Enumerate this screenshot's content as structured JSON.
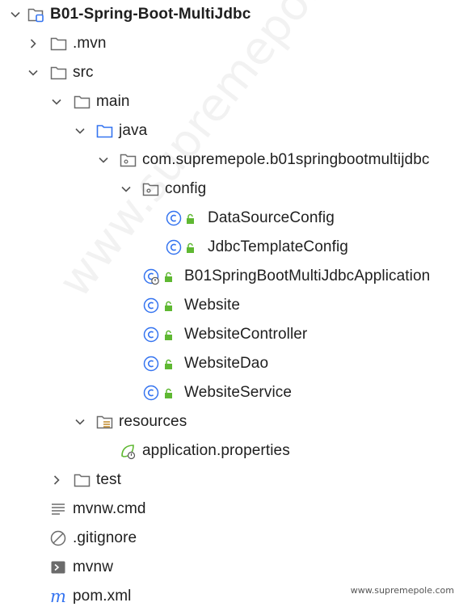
{
  "tree": {
    "project": "B01-Spring-Boot-MultiJdbc",
    "mvn": ".mvn",
    "src": "src",
    "main": "main",
    "java": "java",
    "package": "com.supremepole.b01springbootmultijdbc",
    "config": "config",
    "datasource_config": "DataSourceConfig",
    "jdbc_template_config": "JdbcTemplateConfig",
    "application_class": "B01SpringBootMultiJdbcApplication",
    "website": "Website",
    "website_controller": "WebsiteController",
    "website_dao": "WebsiteDao",
    "website_service": "WebsiteService",
    "resources": "resources",
    "application_properties": "application.properties",
    "test": "test",
    "mvnw_cmd": "mvnw.cmd",
    "gitignore": ".gitignore",
    "mvnw": "mvnw",
    "pom": "pom.xml"
  },
  "watermark": "www.supremepole.com",
  "footer": "www.supremepole.com",
  "colors": {
    "folder_stroke": "#6b6b6b",
    "java_folder": "#3574f0",
    "class_icon": "#3574f0",
    "lock_icon": "#5fb832",
    "spring_leaf": "#5fb832",
    "maven_m": "#3574f0"
  }
}
